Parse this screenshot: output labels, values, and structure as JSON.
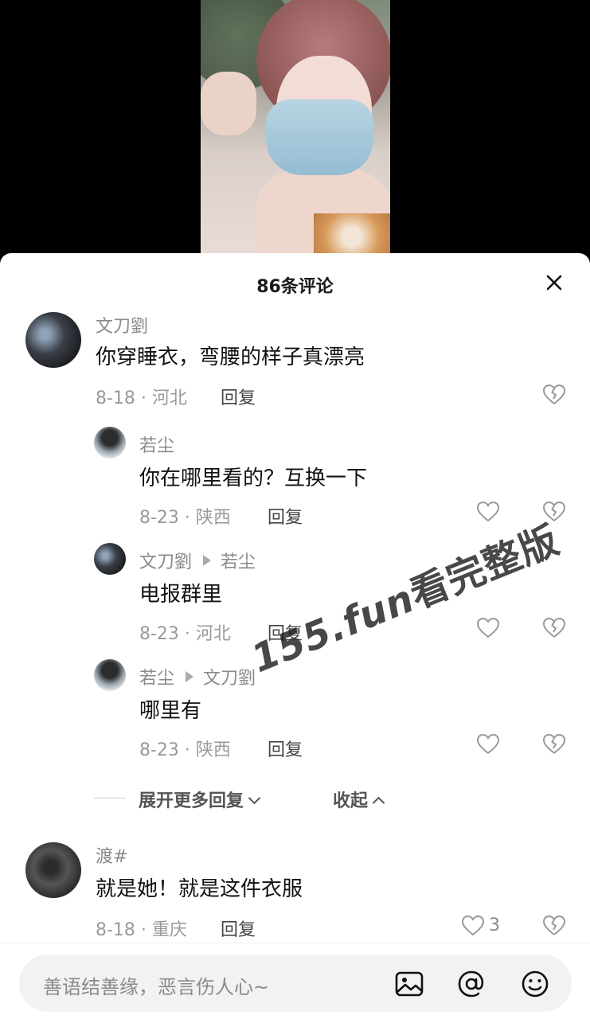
{
  "sheet": {
    "title": "86条评论"
  },
  "watermark": {
    "url": "155.fun",
    "text": "看完整版"
  },
  "comments": [
    {
      "user": "文刀劉",
      "text": "你穿睡衣，弯腰的样子真漂亮",
      "meta": "8-18 · 河北",
      "reply_label": "回复",
      "replies": [
        {
          "user": "若尘",
          "reply_to": "",
          "text": "你在哪里看的？互换一下",
          "meta": "8-23 · 陕西",
          "reply_label": "回复"
        },
        {
          "user": "文刀劉",
          "reply_to": "若尘",
          "text": "电报群里",
          "meta": "8-23 · 河北",
          "reply_label": "回复"
        },
        {
          "user": "若尘",
          "reply_to": "文刀劉",
          "text": "哪里有",
          "meta": "8-23 · 陕西",
          "reply_label": "回复"
        }
      ],
      "expand_more": "展开更多回复",
      "collapse": "收起"
    },
    {
      "user": "渡#",
      "text": "就是她！就是这件衣服",
      "meta": "8-18 · 重庆",
      "reply_label": "回复",
      "like_count": "3"
    }
  ],
  "input": {
    "placeholder": "善语结善缘，恶言伤人心~"
  },
  "icons": {
    "close": "close-icon",
    "like": "heart-icon",
    "dislike": "broken-heart-icon",
    "image": "image-icon",
    "mention": "at-icon",
    "emoji": "emoji-icon"
  },
  "colors": {
    "background": "#000000",
    "sheet": "#ffffff",
    "secondary_text": "#8a8a8a"
  }
}
